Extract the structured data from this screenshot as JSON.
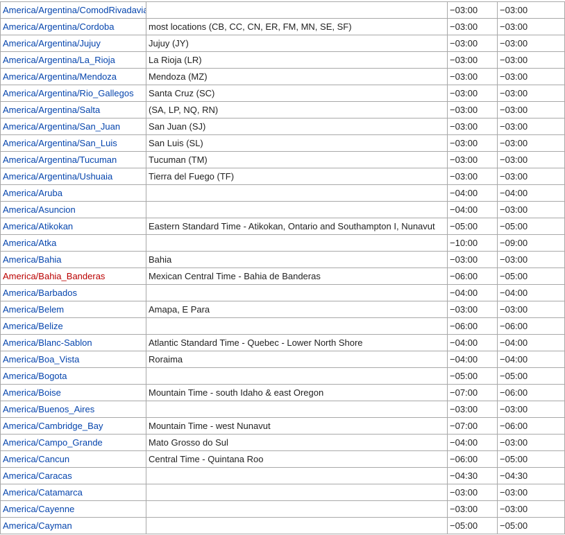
{
  "links": {
    "default_color": "#0645ad",
    "missing_page_color": "#ba0000"
  },
  "rows": [
    {
      "tz": "America/Argentina/ComodRivadavia",
      "comment": "",
      "utc": "−03:00",
      "dst": "−03:00"
    },
    {
      "tz": "America/Argentina/Cordoba",
      "comment": "most locations (CB, CC, CN, ER, FM, MN, SE, SF)",
      "utc": "−03:00",
      "dst": "−03:00"
    },
    {
      "tz": "America/Argentina/Jujuy",
      "comment": "Jujuy (JY)",
      "utc": "−03:00",
      "dst": "−03:00"
    },
    {
      "tz": "America/Argentina/La_Rioja",
      "comment": "La Rioja (LR)",
      "utc": "−03:00",
      "dst": "−03:00"
    },
    {
      "tz": "America/Argentina/Mendoza",
      "comment": "Mendoza (MZ)",
      "utc": "−03:00",
      "dst": "−03:00"
    },
    {
      "tz": "America/Argentina/Rio_Gallegos",
      "comment": "Santa Cruz (SC)",
      "utc": "−03:00",
      "dst": "−03:00"
    },
    {
      "tz": "America/Argentina/Salta",
      "comment": "(SA, LP, NQ, RN)",
      "utc": "−03:00",
      "dst": "−03:00"
    },
    {
      "tz": "America/Argentina/San_Juan",
      "comment": "San Juan (SJ)",
      "utc": "−03:00",
      "dst": "−03:00"
    },
    {
      "tz": "America/Argentina/San_Luis",
      "comment": "San Luis (SL)",
      "utc": "−03:00",
      "dst": "−03:00"
    },
    {
      "tz": "America/Argentina/Tucuman",
      "comment": "Tucuman (TM)",
      "utc": "−03:00",
      "dst": "−03:00"
    },
    {
      "tz": "America/Argentina/Ushuaia",
      "comment": "Tierra del Fuego (TF)",
      "utc": "−03:00",
      "dst": "−03:00"
    },
    {
      "tz": "America/Aruba",
      "comment": "",
      "utc": "−04:00",
      "dst": "−04:00"
    },
    {
      "tz": "America/Asuncion",
      "comment": "",
      "utc": "−04:00",
      "dst": "−03:00"
    },
    {
      "tz": "America/Atikokan",
      "comment": "Eastern Standard Time - Atikokan, Ontario and Southampton I, Nunavut",
      "utc": "−05:00",
      "dst": "−05:00"
    },
    {
      "tz": "America/Atka",
      "comment": "",
      "utc": "−10:00",
      "dst": "−09:00"
    },
    {
      "tz": "America/Bahia",
      "comment": "Bahia",
      "utc": "−03:00",
      "dst": "−03:00"
    },
    {
      "tz": "America/Bahia_Banderas",
      "comment": "Mexican Central Time - Bahia de Banderas",
      "utc": "−06:00",
      "dst": "−05:00",
      "missing": true
    },
    {
      "tz": "America/Barbados",
      "comment": "",
      "utc": "−04:00",
      "dst": "−04:00"
    },
    {
      "tz": "America/Belem",
      "comment": "Amapa, E Para",
      "utc": "−03:00",
      "dst": "−03:00"
    },
    {
      "tz": "America/Belize",
      "comment": "",
      "utc": "−06:00",
      "dst": "−06:00"
    },
    {
      "tz": "America/Blanc-Sablon",
      "comment": "Atlantic Standard Time - Quebec - Lower North Shore",
      "utc": "−04:00",
      "dst": "−04:00"
    },
    {
      "tz": "America/Boa_Vista",
      "comment": "Roraima",
      "utc": "−04:00",
      "dst": "−04:00"
    },
    {
      "tz": "America/Bogota",
      "comment": "",
      "utc": "−05:00",
      "dst": "−05:00"
    },
    {
      "tz": "America/Boise",
      "comment": "Mountain Time - south Idaho & east Oregon",
      "utc": "−07:00",
      "dst": "−06:00"
    },
    {
      "tz": "America/Buenos_Aires",
      "comment": "",
      "utc": "−03:00",
      "dst": "−03:00"
    },
    {
      "tz": "America/Cambridge_Bay",
      "comment": "Mountain Time - west Nunavut",
      "utc": "−07:00",
      "dst": "−06:00"
    },
    {
      "tz": "America/Campo_Grande",
      "comment": "Mato Grosso do Sul",
      "utc": "−04:00",
      "dst": "−03:00"
    },
    {
      "tz": "America/Cancun",
      "comment": "Central Time - Quintana Roo",
      "utc": "−06:00",
      "dst": "−05:00"
    },
    {
      "tz": "America/Caracas",
      "comment": "",
      "utc": "−04:30",
      "dst": "−04:30"
    },
    {
      "tz": "America/Catamarca",
      "comment": "",
      "utc": "−03:00",
      "dst": "−03:00"
    },
    {
      "tz": "America/Cayenne",
      "comment": "",
      "utc": "−03:00",
      "dst": "−03:00"
    },
    {
      "tz": "America/Cayman",
      "comment": "",
      "utc": "−05:00",
      "dst": "−05:00"
    }
  ]
}
